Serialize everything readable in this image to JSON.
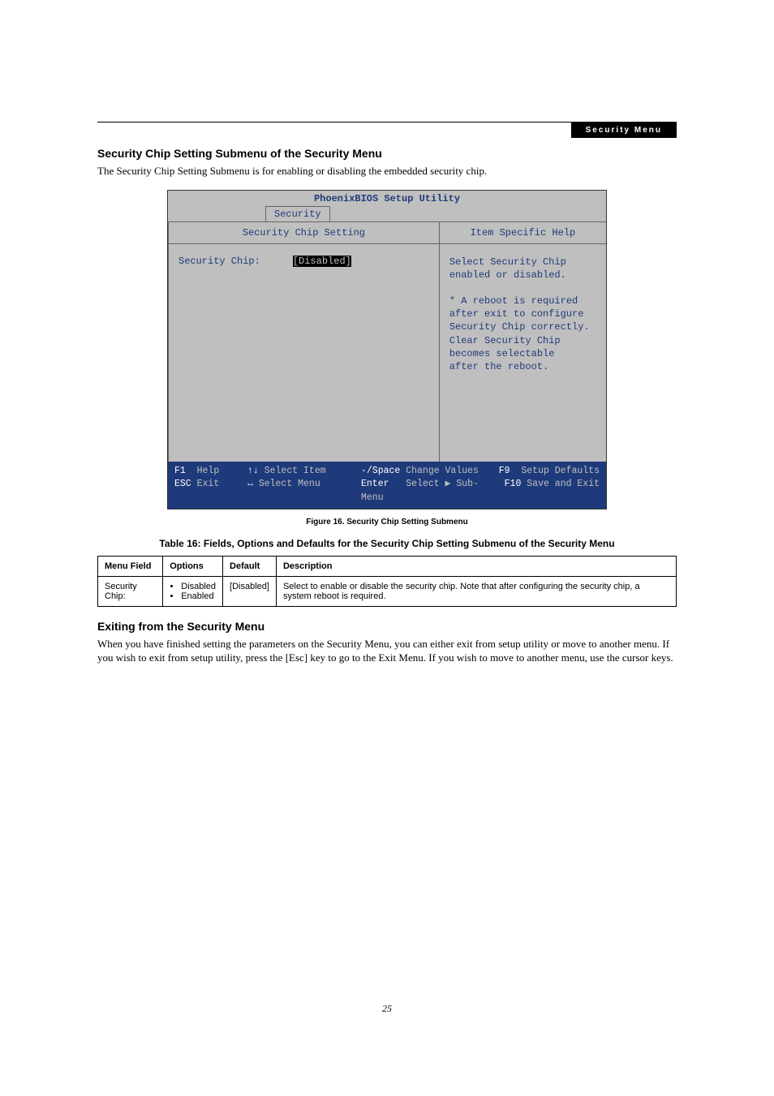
{
  "header": {
    "tag": "Security Menu"
  },
  "section1": {
    "title": "Security Chip Setting Submenu of the Security Menu",
    "intro": "The Security Chip Setting Submenu is for enabling or disabling the embedded security chip."
  },
  "bios": {
    "utility_title": "PhoenixBIOS Setup Utility",
    "tab": "Security",
    "left_header": "Security Chip Setting",
    "right_header": "Item Specific Help",
    "field_label": "Security Chip:",
    "field_value": "[Disabled]",
    "help_lines": [
      "Select Security Chip",
      "enabled or disabled.",
      "",
      "* A reboot is required",
      "after exit to configure",
      "Security Chip correctly.",
      "Clear Security Chip",
      "becomes selectable",
      "after the reboot."
    ],
    "footer": {
      "r1": {
        "k1": "F1",
        "a1": "Help",
        "k2": "↑↓",
        "a2": "Select Item",
        "k3": "-/Space",
        "a3": "Change Values",
        "k4": "F9",
        "a4": "Setup Defaults"
      },
      "r2": {
        "k1": "ESC",
        "a1": "Exit",
        "k2": "↔",
        "a2": "Select Menu",
        "k3": "Enter",
        "a3": "Select ▶ Sub-Menu",
        "k4": "F10",
        "a4": "Save and Exit"
      }
    }
  },
  "figure_caption": "Figure 16.   Security Chip Setting Submenu",
  "table_caption": "Table 16: Fields, Options and Defaults for the Security Chip Setting Submenu of the Security Menu",
  "table": {
    "headers": [
      "Menu Field",
      "Options",
      "Default",
      "Description"
    ],
    "row": {
      "field": "Security Chip:",
      "options": [
        "Disabled",
        "Enabled"
      ],
      "def": "[Disabled]",
      "desc": "Select to enable or disable the security chip. Note that after configuring the security chip, a system reboot is required."
    }
  },
  "section2": {
    "title": "Exiting from the Security Menu",
    "body": "When you have finished setting the parameters on the Security Menu, you can either exit from setup utility or move to another menu. If you wish to exit from setup utility, press the [Esc] key to go to the Exit Menu. If you wish to move to another menu, use the cursor keys."
  },
  "page_number": "25"
}
